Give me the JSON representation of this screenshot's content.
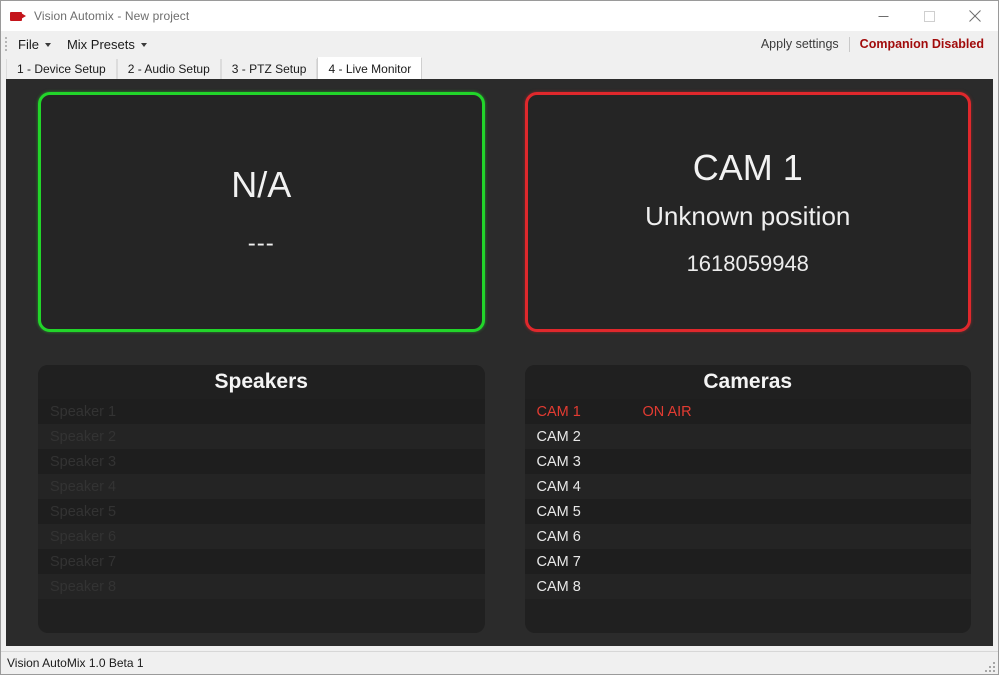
{
  "window": {
    "title": "Vision Automix - New project",
    "icon": "video-camera-icon",
    "minimize_label": "Minimize",
    "maximize_label": "Maximize",
    "close_label": "Close"
  },
  "menubar": {
    "items": [
      {
        "label": "File"
      },
      {
        "label": "Mix Presets"
      }
    ],
    "apply_settings_label": "Apply settings",
    "companion_status": "Companion Disabled",
    "companion_status_color": "#a10b0b"
  },
  "tabs": [
    {
      "label": "1 - Device Setup",
      "active": false
    },
    {
      "label": "2 - Audio Setup",
      "active": false
    },
    {
      "label": "3 - PTZ Setup",
      "active": false
    },
    {
      "label": "4 - Live Monitor",
      "active": true
    }
  ],
  "monitors": {
    "preview": {
      "border_color": "#22d52a",
      "title": "N/A",
      "subtitle": "---"
    },
    "program": {
      "border_color": "#e0282c",
      "title": "CAM 1",
      "subtitle": "Unknown position",
      "id": "1618059948"
    }
  },
  "speakers_panel": {
    "header": "Speakers",
    "rows": [
      {
        "name": "Speaker 1",
        "status": ""
      },
      {
        "name": "Speaker 2",
        "status": ""
      },
      {
        "name": "Speaker 3",
        "status": ""
      },
      {
        "name": "Speaker 4",
        "status": ""
      },
      {
        "name": "Speaker 5",
        "status": ""
      },
      {
        "name": "Speaker 6",
        "status": ""
      },
      {
        "name": "Speaker 7",
        "status": ""
      },
      {
        "name": "Speaker 8",
        "status": ""
      }
    ]
  },
  "cameras_panel": {
    "header": "Cameras",
    "onair_color": "#e23b32",
    "rows": [
      {
        "name": "CAM 1",
        "status": "ON AIR",
        "onair": true
      },
      {
        "name": "CAM 2",
        "status": "",
        "onair": false
      },
      {
        "name": "CAM 3",
        "status": "",
        "onair": false
      },
      {
        "name": "CAM 4",
        "status": "",
        "onair": false
      },
      {
        "name": "CAM 5",
        "status": "",
        "onair": false
      },
      {
        "name": "CAM 6",
        "status": "",
        "onair": false
      },
      {
        "name": "CAM 7",
        "status": "",
        "onair": false
      },
      {
        "name": "CAM 8",
        "status": "",
        "onair": false
      }
    ]
  },
  "statusbar": {
    "text": "Vision AutoMix 1.0 Beta 1"
  }
}
